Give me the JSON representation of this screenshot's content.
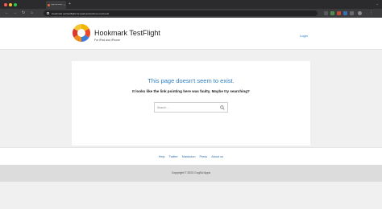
{
  "browser": {
    "tab": {
      "title": "Page not found – Hookmark TestFlight"
    },
    "url": "hookmark.net/testflight-for-ipad-and-iphone-not-found",
    "colors": {
      "close": "#ff5f57",
      "minimize": "#febc2e",
      "maximize": "#28c840"
    }
  },
  "header": {
    "site_title": "Hookmark TestFlight",
    "tagline": "For iPad and iPhone",
    "login_label": "Login"
  },
  "main": {
    "error_title": "This page doesn't seem to exist.",
    "error_message": "It looks like the link pointing here was faulty. Maybe try searching?",
    "search_placeholder": "Search ..."
  },
  "footer": {
    "nav": [
      "Help",
      "Twitter",
      "Mastodon",
      "Press",
      "About us"
    ],
    "copyright": "Copyright © 2023 CogSci Apps"
  }
}
